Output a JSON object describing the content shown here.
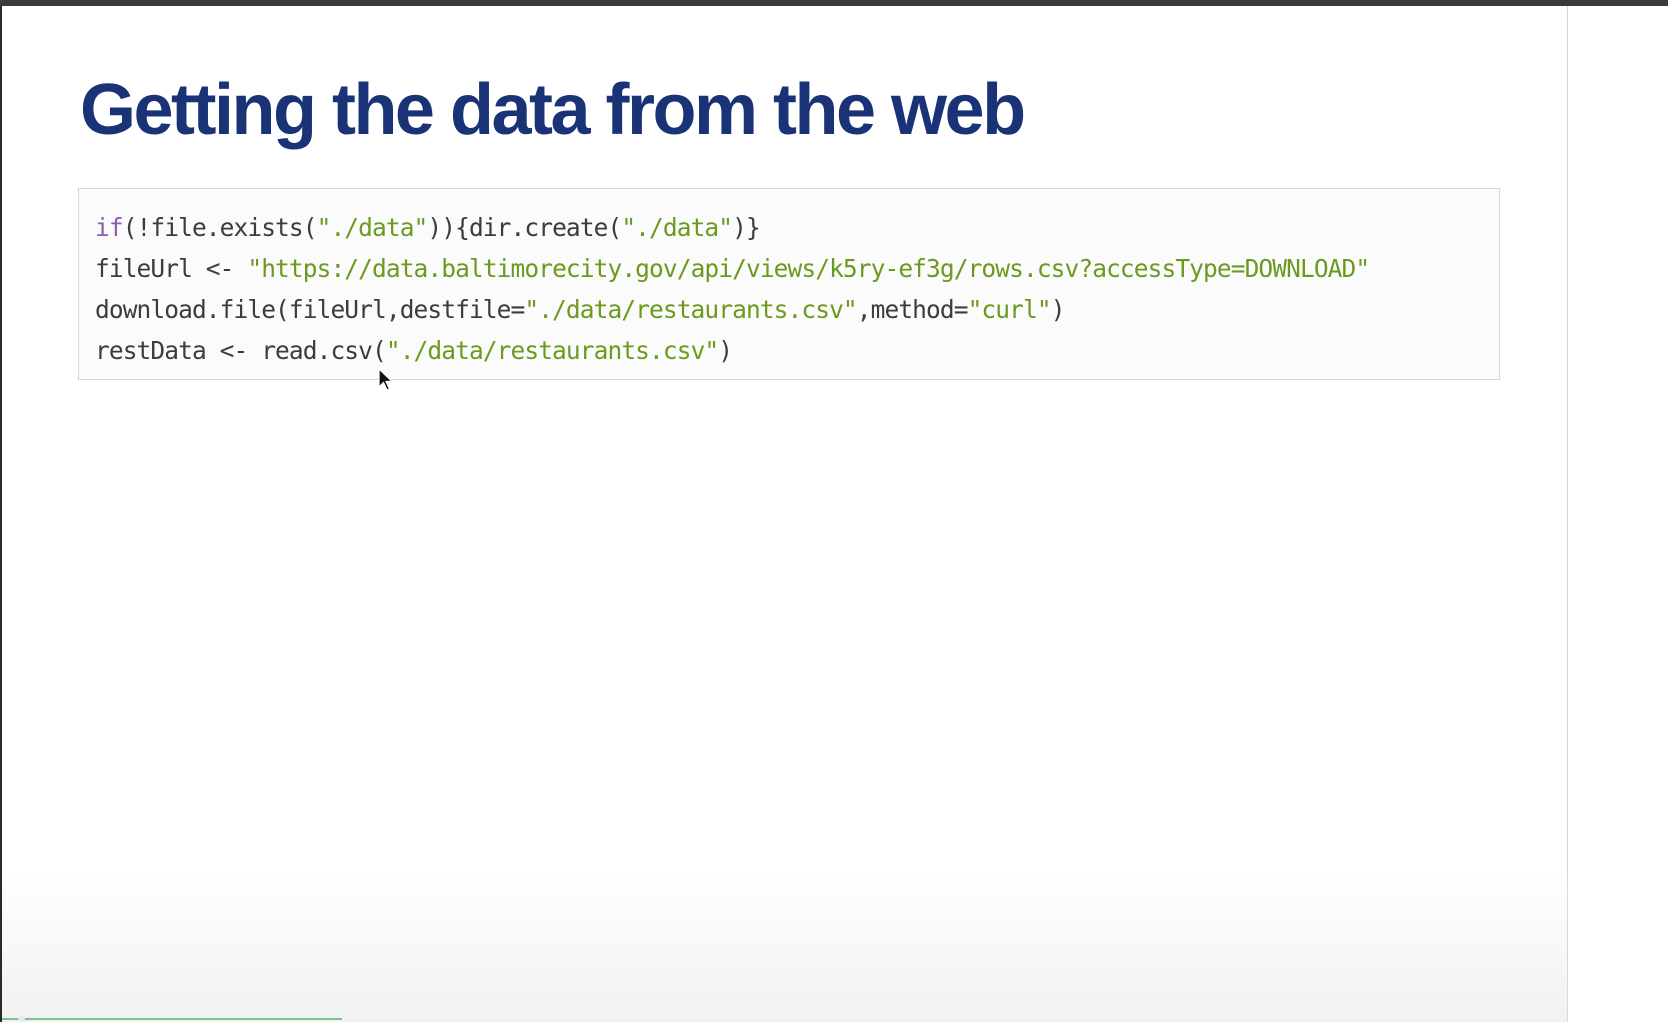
{
  "slide": {
    "title": "Getting the data from the web",
    "code_lines": [
      {
        "tokens": [
          {
            "text": "if",
            "kind": "kw"
          },
          {
            "text": "(!file.exists(",
            "kind": "plain"
          },
          {
            "text": "\"./data\"",
            "kind": "str"
          },
          {
            "text": ")){dir.create(",
            "kind": "plain"
          },
          {
            "text": "\"./data\"",
            "kind": "str"
          },
          {
            "text": ")}",
            "kind": "plain"
          }
        ]
      },
      {
        "tokens": [
          {
            "text": "fileUrl <- ",
            "kind": "plain"
          },
          {
            "text": "\"https://data.baltimorecity.gov/api/views/k5ry-ef3g/rows.csv?accessType=DOWNLOAD\"",
            "kind": "str"
          }
        ]
      },
      {
        "tokens": [
          {
            "text": "download.file(fileUrl,destfile=",
            "kind": "plain"
          },
          {
            "text": "\"./data/restaurants.csv\"",
            "kind": "str"
          },
          {
            "text": ",method=",
            "kind": "plain"
          },
          {
            "text": "\"curl\"",
            "kind": "str"
          },
          {
            "text": ")",
            "kind": "plain"
          }
        ]
      },
      {
        "tokens": [
          {
            "text": "restData <- read.csv(",
            "kind": "plain"
          },
          {
            "text": "\"./data/restaurants.csv\"",
            "kind": "str"
          },
          {
            "text": ")",
            "kind": "plain"
          }
        ]
      }
    ]
  },
  "colors": {
    "title": "#1a3377",
    "keyword": "#8a5fb0",
    "string": "#6c9a1e",
    "code_text": "#3c3c3c",
    "progress": "#7dbf8f"
  },
  "icons": {
    "cursor": "mouse-pointer-icon"
  }
}
